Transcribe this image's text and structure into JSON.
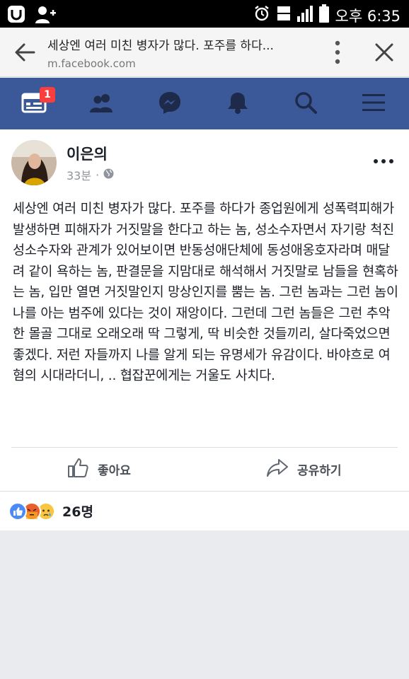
{
  "status_bar": {
    "time": "오후 6:35"
  },
  "browser": {
    "page_title": "세상엔 여러 미친 병자가 많다. 포주를 하다...",
    "url": "m.facebook.com"
  },
  "nav": {
    "badge_count": "1"
  },
  "post": {
    "author": "이은의",
    "timestamp": "33분",
    "text": "세상엔 여러 미친 병자가 많다. 포주를 하다가 종업원에게 성폭력피해가 발생하면 피해자가 거짓말을 한다고 하는 놈, 성소수자면서 자기랑 척진 성소수자와 관계가 있어보이면 반동성애단체에 동성애옹호자라며 매달려 같이 욕하는 놈, 판결문을 지맘대로 해석해서 거짓말로 남들을 현혹하는 놈, 입만 열면 거짓말인지 망상인지를 뿜는 놈. 그런 놈과는 그런 놈이 나를 아는 범주에 있다는 것이 재앙이다. 그런데 그런 놈들은 그런 추악한 몰골 그대로 오래오래 딱 그렇게, 딱 비슷한 것들끼리, 살다죽었으면 좋겠다. 저런 자들까지 나를 알게 되는 유명세가 유감이다. 바야흐로 여혐의 시대라더니, .. 협잡꾼에게는 거울도 사치다.",
    "like_label": "좋아요",
    "share_label": "공유하기",
    "reaction_count": "26명"
  },
  "colors": {
    "fb_blue": "#3b5998",
    "badge_red": "#fa3e3e"
  }
}
